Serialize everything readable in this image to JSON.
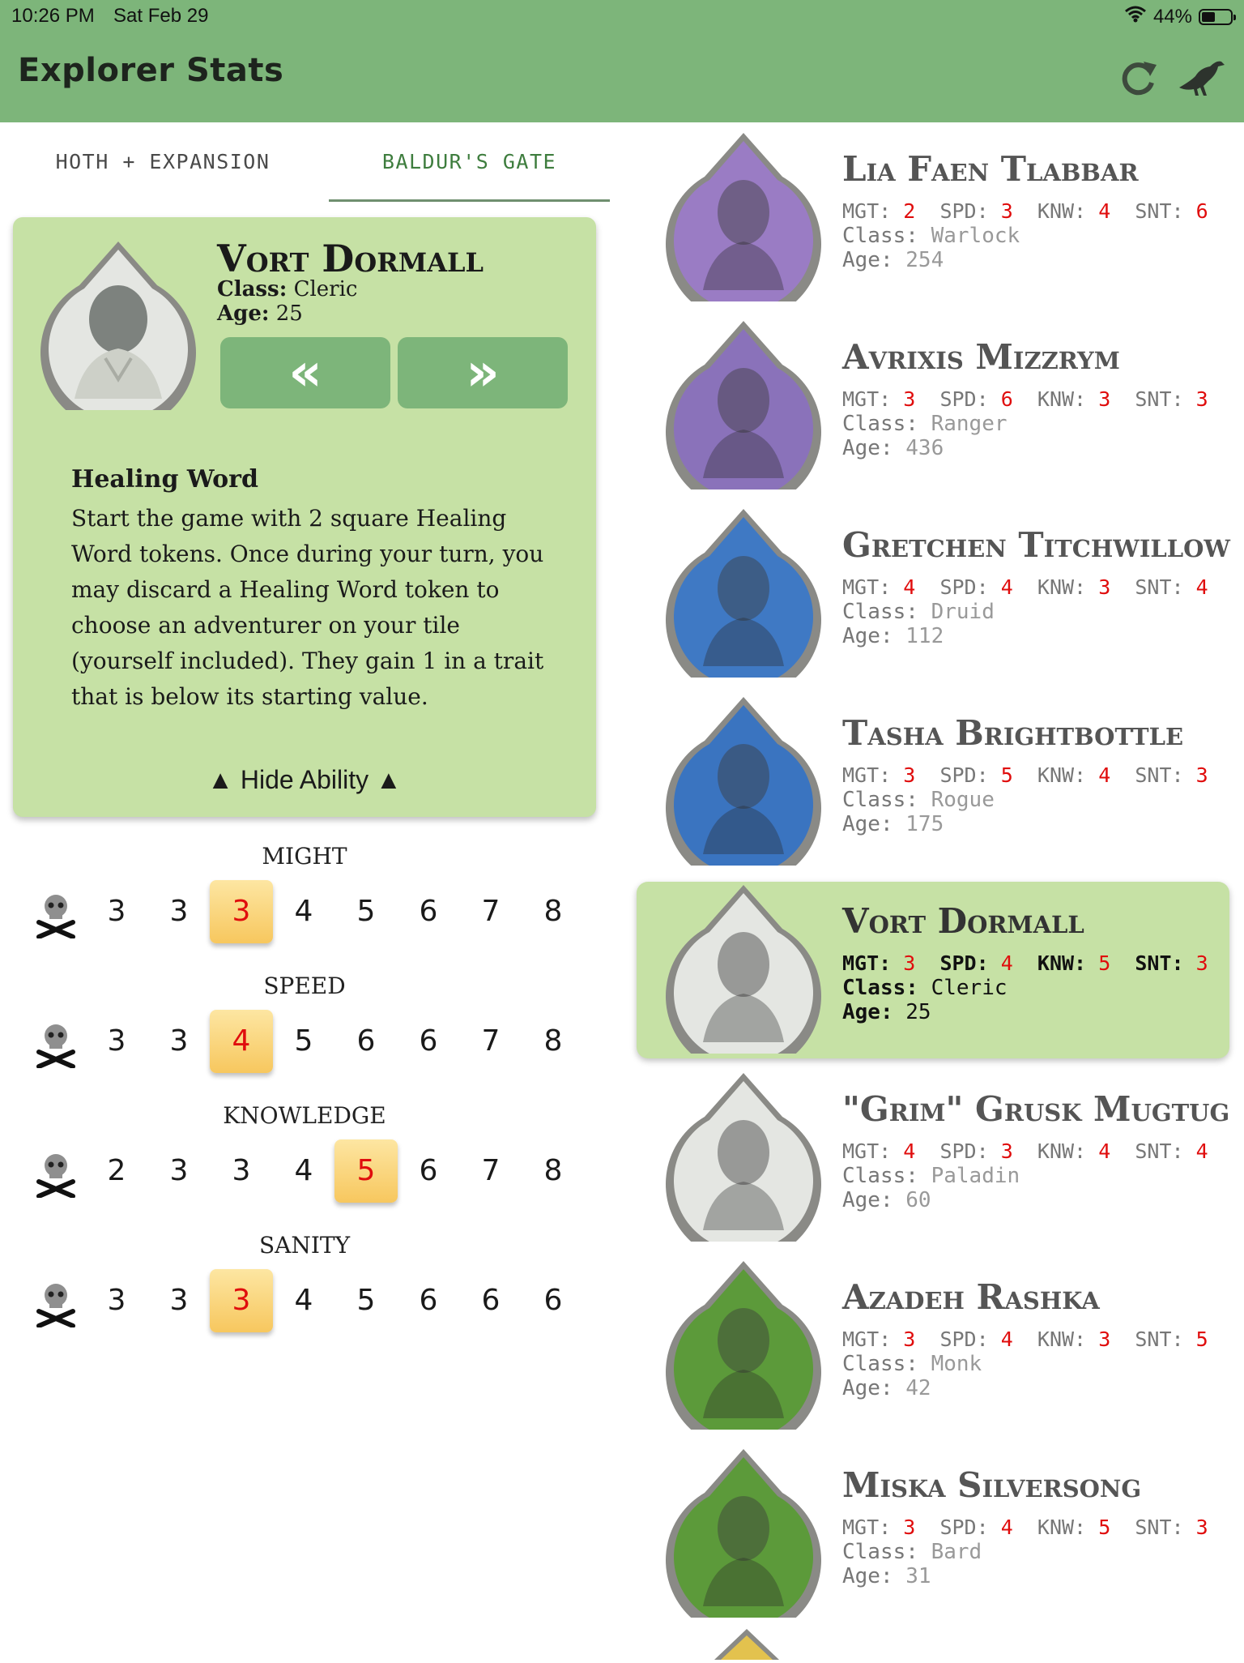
{
  "status_bar": {
    "time": "10:26 PM",
    "date": "Sat Feb 29",
    "battery": "44%"
  },
  "header": {
    "title": "Explorer Stats",
    "refresh_icon": "refresh-icon",
    "raven_icon": "raven-icon"
  },
  "tabs": [
    {
      "label": "HOTH + EXPANSION",
      "active": false
    },
    {
      "label": "BALDUR'S GATE",
      "active": true
    }
  ],
  "selected": {
    "name": "Vort Dormall",
    "class_label": "Class:",
    "class": "Cleric",
    "age_label": "Age:",
    "age": "25",
    "prev_label": "«",
    "next_label": "»",
    "ability_title": "Healing Word",
    "ability_text": "Start the game with 2 square Healing Word tokens. Once during your turn, you may discard a Healing Word token to choose an adventurer on your tile (yourself included). They gain 1 in a trait that is below its starting value.",
    "hide_ability": "Hide Ability",
    "portrait_color": "#e4e6e2"
  },
  "traits": [
    {
      "label": "MIGHT",
      "values": [
        "3",
        "3",
        "3",
        "4",
        "5",
        "6",
        "7",
        "8"
      ],
      "current_index": 2
    },
    {
      "label": "SPEED",
      "values": [
        "3",
        "3",
        "4",
        "5",
        "6",
        "6",
        "7",
        "8"
      ],
      "current_index": 2
    },
    {
      "label": "KNOWLEDGE",
      "values": [
        "2",
        "3",
        "3",
        "4",
        "5",
        "6",
        "7",
        "8"
      ],
      "current_index": 4
    },
    {
      "label": "SANITY",
      "values": [
        "3",
        "3",
        "3",
        "4",
        "5",
        "6",
        "6",
        "6"
      ],
      "current_index": 2
    }
  ],
  "explorers": [
    {
      "name": "Lia Faen Tlabbar",
      "mgt": "2",
      "spd": "3",
      "knw": "4",
      "snt": "6",
      "class": "Warlock",
      "age": "254",
      "color": "#9a7cc4"
    },
    {
      "name": "Avrixis Mizzrym",
      "mgt": "3",
      "spd": "6",
      "knw": "3",
      "snt": "3",
      "class": "Ranger",
      "age": "436",
      "color": "#8a72ba"
    },
    {
      "name": "Gretchen Titchwillow",
      "mgt": "4",
      "spd": "4",
      "knw": "3",
      "snt": "4",
      "class": "Druid",
      "age": "112",
      "color": "#3f79c4"
    },
    {
      "name": "Tasha Brightbottle",
      "mgt": "3",
      "spd": "5",
      "knw": "4",
      "snt": "3",
      "class": "Rogue",
      "age": "175",
      "color": "#3a74c0"
    },
    {
      "name": "Vort Dormall",
      "mgt": "3",
      "spd": "4",
      "knw": "5",
      "snt": "3",
      "class": "Cleric",
      "age": "25",
      "color": "#e4e6e2",
      "selected": true
    },
    {
      "name": "\"Grim\" Grusk Mugtug",
      "mgt": "4",
      "spd": "3",
      "knw": "4",
      "snt": "4",
      "class": "Paladin",
      "age": "60",
      "color": "#e4e6e2"
    },
    {
      "name": "Azadeh Rashka",
      "mgt": "3",
      "spd": "4",
      "knw": "3",
      "snt": "5",
      "class": "Monk",
      "age": "42",
      "color": "#5c9a3a"
    },
    {
      "name": "Miska Silversong",
      "mgt": "3",
      "spd": "4",
      "knw": "5",
      "snt": "3",
      "class": "Bard",
      "age": "31",
      "color": "#5c9a3a"
    }
  ],
  "list_labels": {
    "mgt": "MGT:",
    "spd": "SPD:",
    "knw": "KNW:",
    "snt": "SNT:",
    "class": "Class:",
    "age": "Age:"
  }
}
